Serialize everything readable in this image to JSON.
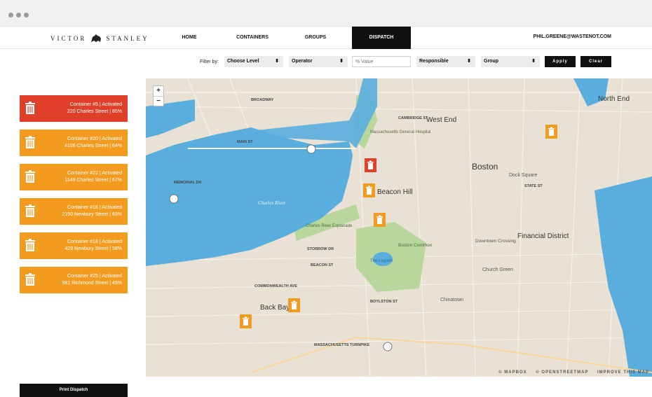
{
  "nav": {
    "brand_left": "VICTOR",
    "brand_right": "STANLEY",
    "items": [
      "HOME",
      "CONTAINERS",
      "GROUPS",
      "DISPATCH"
    ],
    "active": "DISPATCH",
    "user_email": "PHIL.GREENE@WASTENOT.COM"
  },
  "filters": {
    "label": "Filter by:",
    "level": "Choose Level",
    "operator": "Operator",
    "value_placeholder": "% Value",
    "responsible": "Responsible",
    "group": "Group",
    "apply": "Apply",
    "clear": "Clear"
  },
  "containers": [
    {
      "title": "Container #5 | Activated",
      "address": "220 Charles Street | 85%",
      "status_color": "#e0402a"
    },
    {
      "title": "Container #20 | Activated",
      "address": "4106 Charles Street | 64%",
      "status_color": "#f29b1f"
    },
    {
      "title": "Container #22 | Activated",
      "address": "1149 Charles Street | 67%",
      "status_color": "#f29b1f"
    },
    {
      "title": "Container #16 | Activated",
      "address": "2150 Newbury Street | 63%",
      "status_color": "#f29b1f"
    },
    {
      "title": "Container #18 | Activated",
      "address": "429 Newbury Street | 58%",
      "status_color": "#f29b1f"
    },
    {
      "title": "Container #25 | Activated",
      "address": "981 Richmond Street | 49%",
      "status_color": "#f29b1f"
    }
  ],
  "print_label": "Print Dispatch",
  "map": {
    "zoom_in": "+",
    "zoom_out": "−",
    "labels": {
      "west_end": "West End",
      "north_end": "North End",
      "boston": "Boston",
      "beacon_hill": "Beacon Hill",
      "back_bay": "Back Bay",
      "financial_district": "Financial District",
      "boston_common": "Boston Common",
      "chinatown": "Chinatown",
      "downtown_crossing": "Downtown Crossing",
      "charles_river": "Charles River",
      "the_lagoon": "The Lagoon",
      "storrow_dr": "STORROW DR",
      "mass_turnpike": "MASSACHUSETTS TURNPIKE",
      "commonwealth_ave": "COMMONWEALTH AVE",
      "beacon_st": "BEACON ST",
      "boylston_st": "BOYLSTON ST",
      "cambridge_st": "CAMBRIDGE ST",
      "memorial_dr": "MEMORIAL DR",
      "main_st": "MAIN ST",
      "broadway": "BROADWAY",
      "mass_general": "Massachusetts General Hospital",
      "esplanade": "Charles River Esplanade",
      "church_green": "Church Green",
      "dock_square": "Dock Square",
      "state_st": "STATE ST"
    },
    "attribution": [
      "© MAPBOX",
      "© OPENSTREETMAP",
      "IMPROVE THIS MAP"
    ]
  },
  "colors": {
    "critical": "#e0402a",
    "warning": "#f29b1f",
    "water": "#5aaede",
    "park": "#b9d79c",
    "land": "#e9e2d4"
  }
}
